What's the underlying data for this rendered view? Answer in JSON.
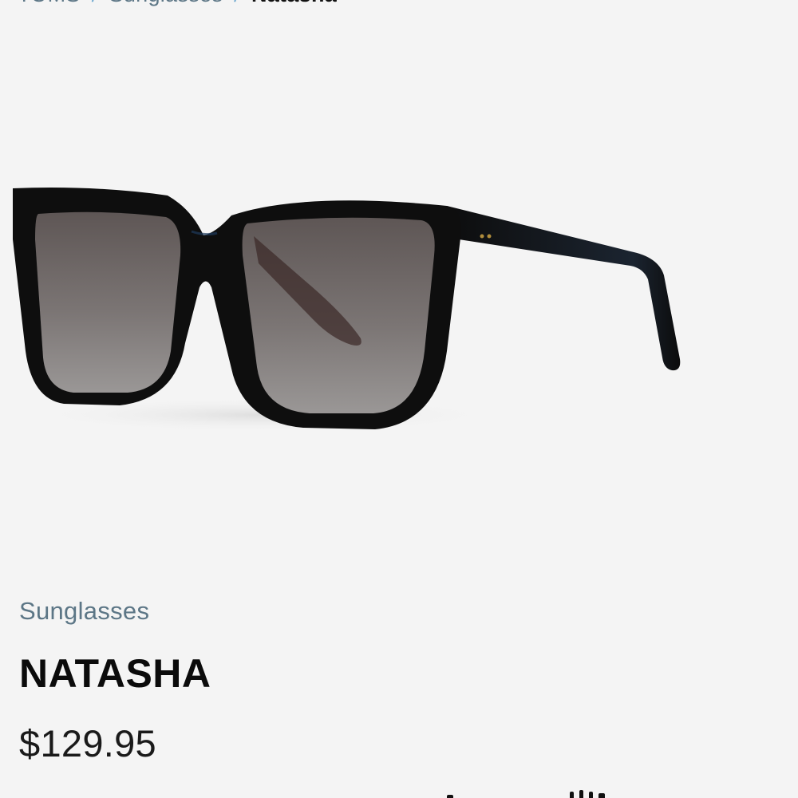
{
  "breadcrumb": {
    "items": [
      "TOMS",
      "Sunglasses"
    ],
    "separator": "/",
    "current": "Natasha"
  },
  "product": {
    "image_alt": "Natasha black sunglasses",
    "category": "Sunglasses",
    "name": "NATASHA",
    "price": "$129.95"
  },
  "colors": {
    "background": "#f4f4f4",
    "muted_text": "#5c7686",
    "separator": "#6fa9cf",
    "frame": "#0e0e0e"
  }
}
